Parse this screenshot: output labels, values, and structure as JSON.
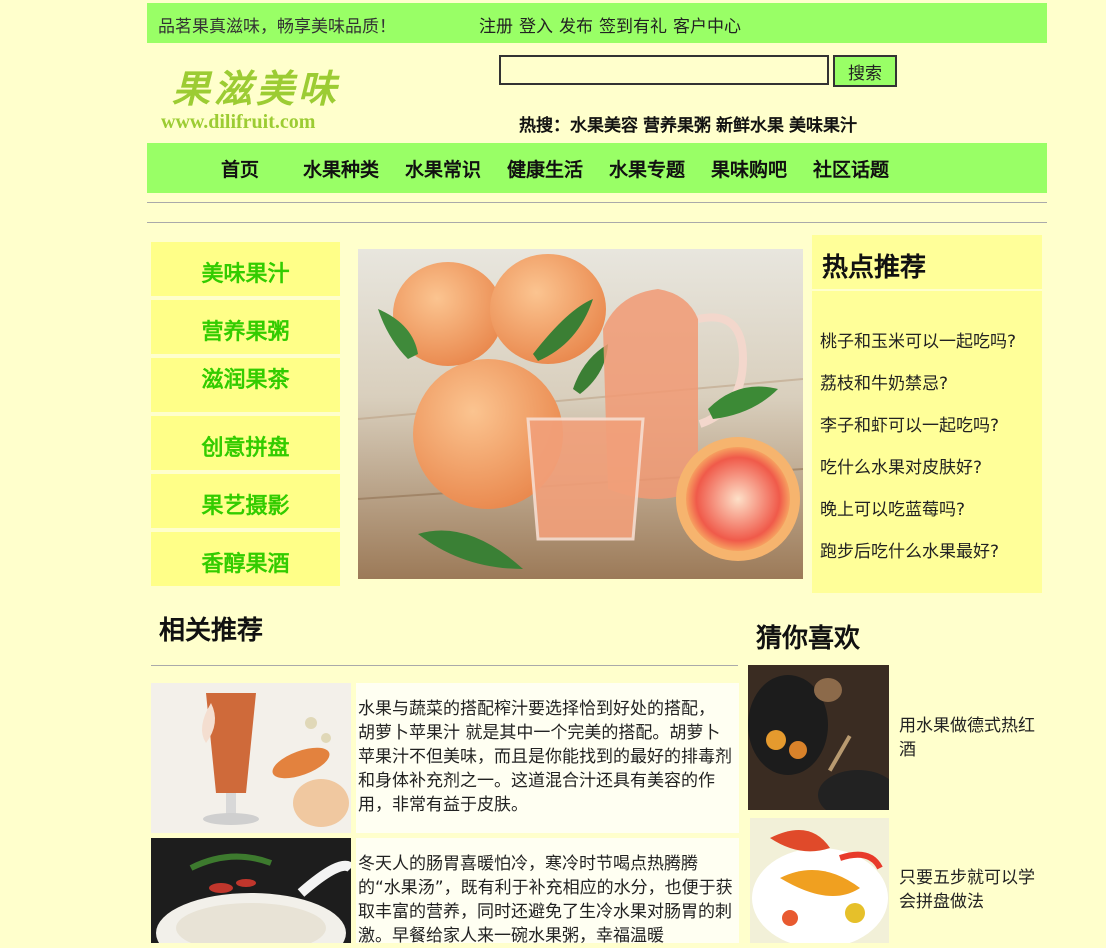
{
  "topbar": {
    "slogan": "品茗果真滋味，畅享美味品质！",
    "links": [
      "注册",
      "登入",
      "发布",
      "签到有礼",
      "客户中心"
    ]
  },
  "logo": {
    "name": "果滋美味",
    "url": "www.dilifruit.com"
  },
  "search": {
    "value": "",
    "placeholder": "",
    "button_label": "搜索"
  },
  "hot_search": {
    "label": "热搜：",
    "items": [
      "水果美容",
      "营养果粥",
      "新鲜水果",
      "美味果汁"
    ]
  },
  "nav": [
    "首页",
    "水果种类",
    "水果常识",
    "健康生活",
    "水果专题",
    "果味购吧",
    "社区话题"
  ],
  "left_menu": [
    "美味果汁",
    "营养果粥",
    "滋润果茶",
    "创意拼盘",
    "果艺摄影",
    "香醇果酒"
  ],
  "hot_panel": {
    "title": "热点推荐",
    "items": [
      "桃子和玉米可以一起吃吗?",
      "荔枝和牛奶禁忌?",
      "李子和虾可以一起吃吗?",
      "吃什么水果对皮肤好?",
      "晚上可以吃蓝莓吗?",
      "跑步后吃什么水果最好?"
    ]
  },
  "related": {
    "title": "相关推荐",
    "articles": [
      "  水果与蔬菜的搭配榨汁要选择恰到好处的搭配， 胡萝卜苹果汁 就是其中一个完美的搭配。胡萝卜苹果汁不但美味，而且是你能找到的最好的排毒剂和身体补充剂之一。这道混合汁还具有美容的作用，非常有益于皮肤。",
      "  冬天人的肠胃喜暖怕冷，寒冷时节喝点热腾腾的“水果汤”，既有利于补充相应的水分，也便于获取丰富的营养，同时还避免了生冷水果对肠胃的刺激。早餐给家人来一碗水果粥，幸福温暖"
    ]
  },
  "guess": {
    "title": "猜你喜欢",
    "items": [
      "用水果做德式热红酒",
      "只要五步就可以学会拼盘做法"
    ]
  },
  "colors": {
    "background": "#ffffcc",
    "green_bar": "#99ff66",
    "menu_yellow": "#ffff88",
    "menu_text": "#33cc00"
  }
}
